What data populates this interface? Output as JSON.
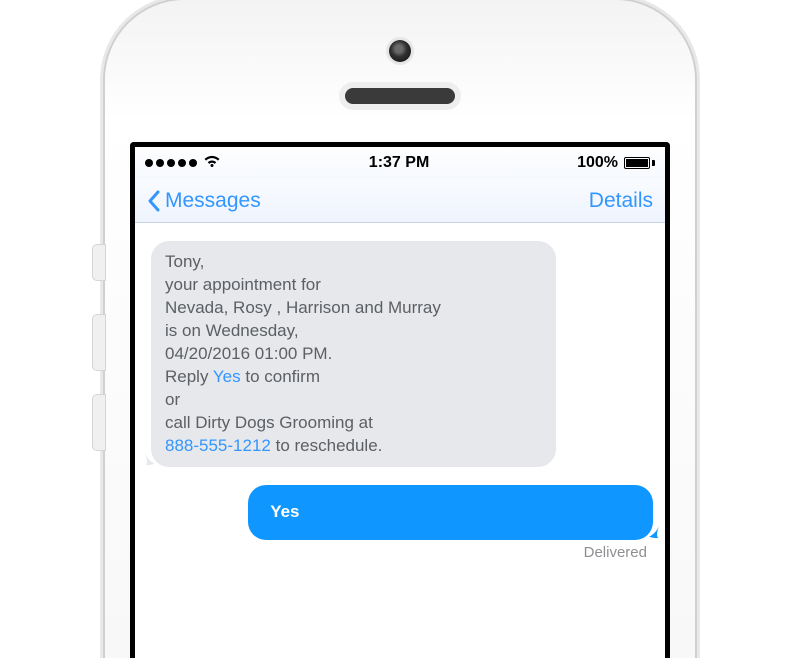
{
  "status": {
    "time": "1:37 PM",
    "battery_pct": "100%"
  },
  "nav": {
    "back_label": "Messages",
    "details_label": "Details"
  },
  "conversation": {
    "incoming": {
      "greeting": "Tony,",
      "line2": "your appointment for",
      "line3": "Nevada, Rosy , Harrison and Murray",
      "line4": "is on Wednesday,",
      "line5": "04/20/2016 01:00 PM.",
      "line6_prefix": "Reply ",
      "line6_link": "Yes",
      "line6_suffix": " to confirm",
      "line7": "or",
      "line8": "call Dirty Dogs Grooming at",
      "line9_link": "888-555-1212",
      "line9_suffix": " to reschedule."
    },
    "outgoing": {
      "text": "Yes"
    },
    "delivered_label": "Delivered"
  }
}
